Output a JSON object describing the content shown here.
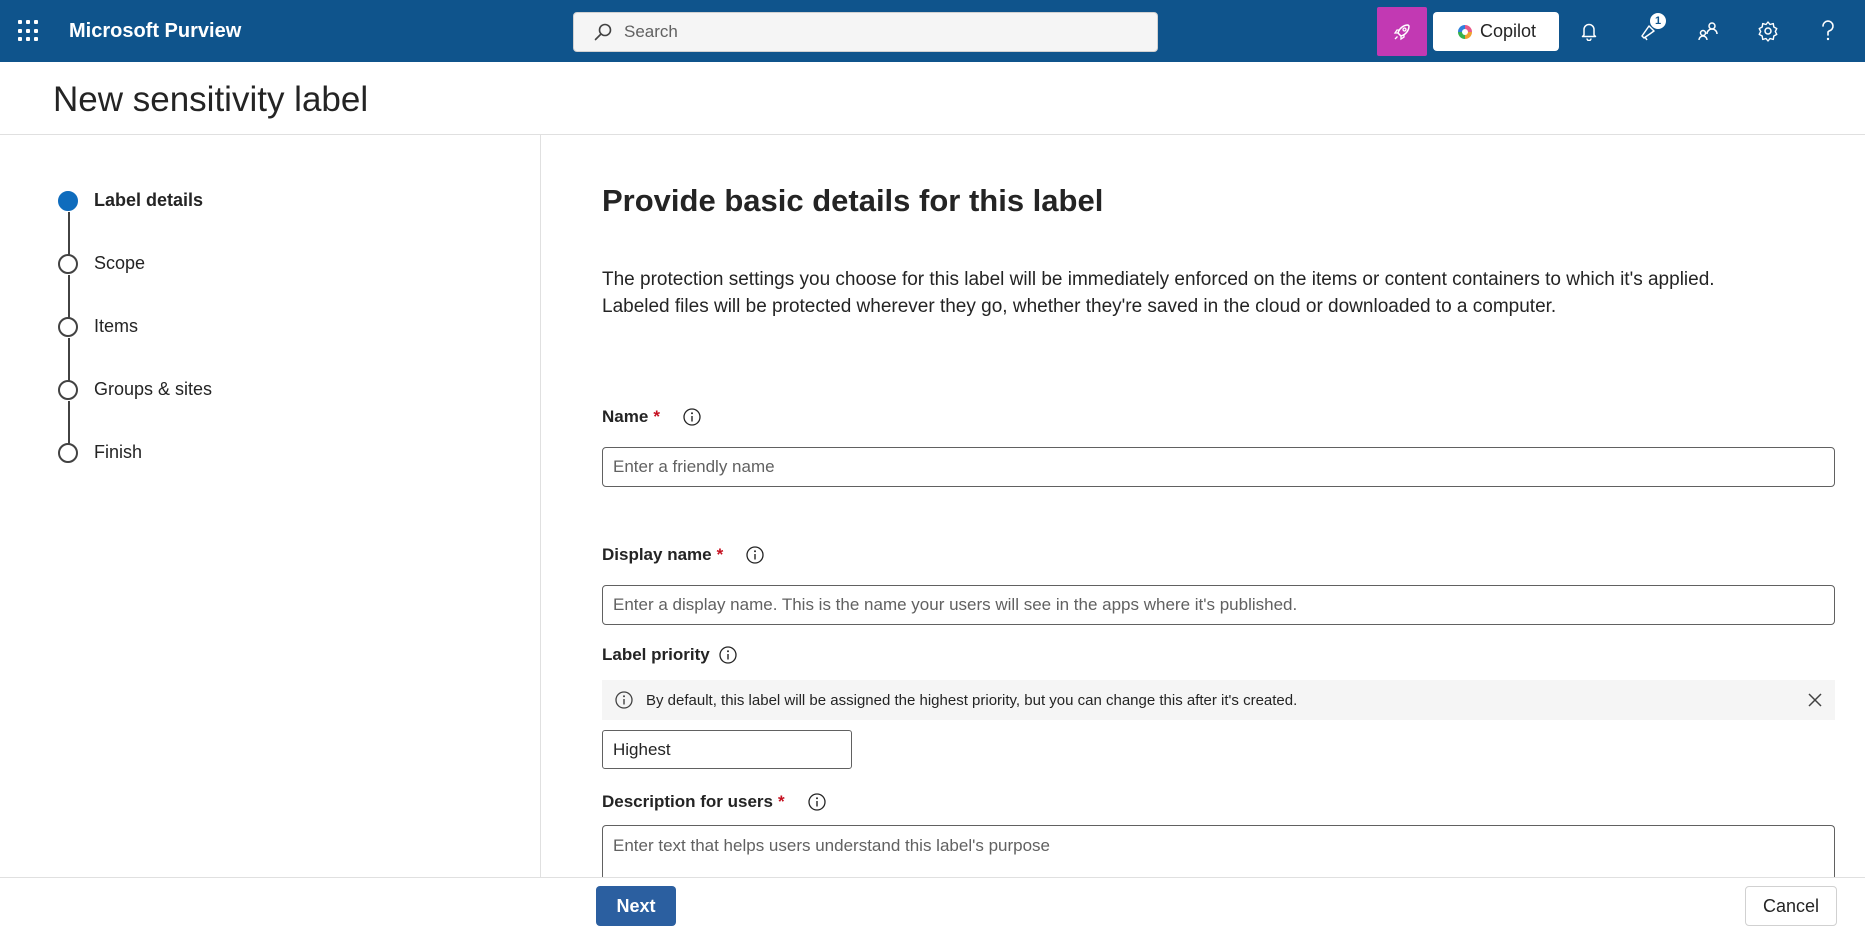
{
  "app": {
    "title": "Microsoft Purview"
  },
  "search": {
    "placeholder": "Search"
  },
  "topbar": {
    "copilot_label": "Copilot",
    "notifications_badge": "1",
    "accent_color": "#0f548c",
    "rocket_color": "#c239b3"
  },
  "page": {
    "title": "New sensitivity label"
  },
  "stepper": {
    "steps": [
      {
        "label": "Label details",
        "active": true
      },
      {
        "label": "Scope",
        "active": false
      },
      {
        "label": "Items",
        "active": false
      },
      {
        "label": "Groups & sites",
        "active": false
      },
      {
        "label": "Finish",
        "active": false
      }
    ]
  },
  "main": {
    "heading": "Provide basic details for this label",
    "intro_line1": "The protection settings you choose for this label will be immediately enforced on the items or content containers to which it's applied.",
    "intro_line2": "Labeled files will be protected wherever they go, whether they're saved in the cloud or downloaded to a computer.",
    "name": {
      "label": "Name",
      "required": "*",
      "placeholder": "Enter a friendly name",
      "value": ""
    },
    "display_name": {
      "label": "Display name",
      "required": "*",
      "placeholder": "Enter a display name. This is the name your users will see in the apps where it's published.",
      "value": ""
    },
    "label_priority": {
      "label": "Label priority",
      "banner_text": "By default, this label will be assigned the highest priority, but you can change this after it's created.",
      "value": "Highest"
    },
    "description": {
      "label": "Description for users",
      "required": "*",
      "placeholder": "Enter text that helps users understand this label's purpose"
    }
  },
  "footer": {
    "next_label": "Next",
    "cancel_label": "Cancel"
  }
}
